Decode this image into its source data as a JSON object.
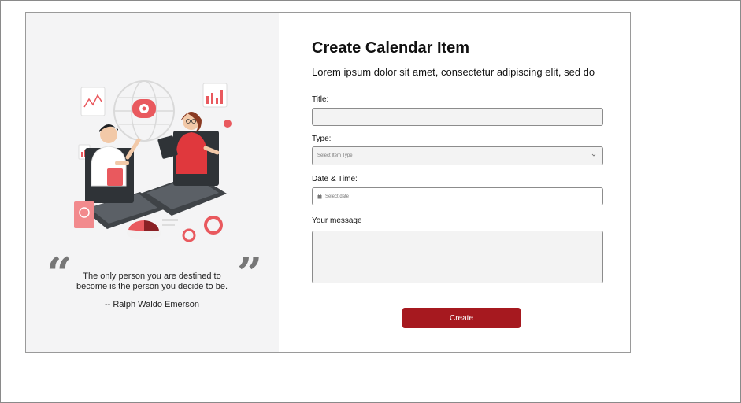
{
  "quote": {
    "open_mark": "“",
    "close_mark": "”",
    "text": "The only person you are destined to become is the person you decide to be.",
    "author": "--  Ralph Waldo Emerson"
  },
  "form": {
    "title": "Create Calendar Item",
    "subtitle": "Lorem ipsum dolor sit amet, consectetur adipiscing elit, sed do",
    "title_label": "Title:",
    "title_value": "",
    "type_label": "Type:",
    "type_placeholder": "Select Item Type",
    "datetime_label": "Date & Time:",
    "datetime_placeholder": "Select date",
    "message_label": "Your message",
    "message_value": "",
    "submit_label": "Create"
  },
  "colors": {
    "accent": "#a6191f",
    "panel_bg": "#f4f4f5",
    "input_bg": "#f3f3f3"
  },
  "icons": {
    "chevron": "chevron-down-icon",
    "calendar": "calendar-icon"
  }
}
